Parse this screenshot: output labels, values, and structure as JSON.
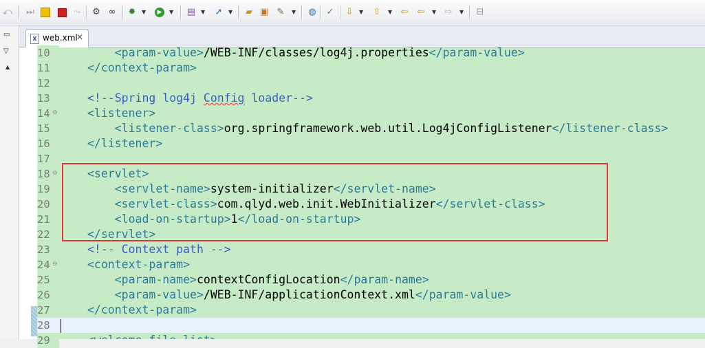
{
  "tab": {
    "label": "web.xml",
    "close": "✕",
    "icon": "X"
  },
  "toolbar": {
    "icons": [
      "undo-icon",
      "skip-icon",
      "pause-icon",
      "stop-icon",
      "disconnect-icon",
      "debug-config-icon",
      "find-icon",
      "debug-icon",
      "run-icon",
      "new-server-icon",
      "deploy-icon",
      "open-folder-icon",
      "open-type-icon",
      "tools-icon",
      "globe-icon",
      "annotation-icon",
      "next-annotation-icon",
      "prev-annotation-icon",
      "back-icon",
      "forward-icon",
      "pin-icon"
    ]
  },
  "lines": [
    {
      "n": "10",
      "fold": "",
      "parts": [
        [
          "    ",
          "txt"
        ],
        [
          "<param-value>",
          "tag"
        ],
        [
          "/WEB-INF/classes/log4j.properties",
          "txt"
        ],
        [
          "</param-value>",
          "tag"
        ]
      ]
    },
    {
      "n": "11",
      "fold": "",
      "parts": [
        [
          "</context-param>",
          "tag"
        ]
      ]
    },
    {
      "n": "12",
      "fold": "",
      "parts": []
    },
    {
      "n": "13",
      "fold": "",
      "parts": [
        [
          "<!--Spring log4j ",
          "cmt"
        ],
        [
          "Config",
          "cmt spell"
        ],
        [
          " loader-->",
          "cmt"
        ]
      ]
    },
    {
      "n": "14",
      "fold": "⊖",
      "parts": [
        [
          "<listener>",
          "tag"
        ]
      ]
    },
    {
      "n": "15",
      "fold": "",
      "parts": [
        [
          "    ",
          "txt"
        ],
        [
          "<listener-class>",
          "tag"
        ],
        [
          "org.springframework.web.util.Log4jConfigListener",
          "txt"
        ],
        [
          "</listener-class>",
          "tag"
        ]
      ]
    },
    {
      "n": "16",
      "fold": "",
      "parts": [
        [
          "</listener>",
          "tag"
        ]
      ]
    },
    {
      "n": "17",
      "fold": "",
      "parts": []
    },
    {
      "n": "18",
      "fold": "⊖",
      "parts": [
        [
          "<servlet>",
          "tag"
        ]
      ]
    },
    {
      "n": "19",
      "fold": "",
      "parts": [
        [
          "    ",
          "txt"
        ],
        [
          "<servlet-name>",
          "tag"
        ],
        [
          "system-initializer",
          "txt"
        ],
        [
          "</servlet-name>",
          "tag"
        ]
      ]
    },
    {
      "n": "20",
      "fold": "",
      "parts": [
        [
          "    ",
          "txt"
        ],
        [
          "<servlet-class>",
          "tag"
        ],
        [
          "com.qlyd.web.init.WebInitializer",
          "txt"
        ],
        [
          "</servlet-class>",
          "tag"
        ]
      ]
    },
    {
      "n": "21",
      "fold": "",
      "parts": [
        [
          "    ",
          "txt"
        ],
        [
          "<load-on-startup>",
          "tag"
        ],
        [
          "1",
          "txt"
        ],
        [
          "</load-on-startup>",
          "tag"
        ]
      ]
    },
    {
      "n": "22",
      "fold": "",
      "parts": [
        [
          "</servlet>",
          "tag"
        ]
      ]
    },
    {
      "n": "23",
      "fold": "",
      "parts": [
        [
          "<!-- Context path -->",
          "cmt"
        ]
      ]
    },
    {
      "n": "24",
      "fold": "⊖",
      "parts": [
        [
          "<context-param>",
          "tag"
        ]
      ]
    },
    {
      "n": "25",
      "fold": "",
      "parts": [
        [
          "    ",
          "txt"
        ],
        [
          "<param-name>",
          "tag"
        ],
        [
          "contextConfigLocation",
          "txt"
        ],
        [
          "</param-name>",
          "tag"
        ]
      ]
    },
    {
      "n": "26",
      "fold": "",
      "parts": [
        [
          "    ",
          "txt"
        ],
        [
          "<param-value>",
          "tag"
        ],
        [
          "/WEB-INF/applicationContext.xml",
          "txt"
        ],
        [
          "</param-value>",
          "tag"
        ]
      ]
    },
    {
      "n": "27",
      "fold": "",
      "parts": [
        [
          "</context-param>",
          "tag"
        ]
      ]
    },
    {
      "n": "28",
      "fold": "",
      "parts": [],
      "current": true
    },
    {
      "n": "29",
      "fold": "",
      "parts": [
        [
          "<welcome-file-list>",
          "tag"
        ]
      ]
    }
  ]
}
